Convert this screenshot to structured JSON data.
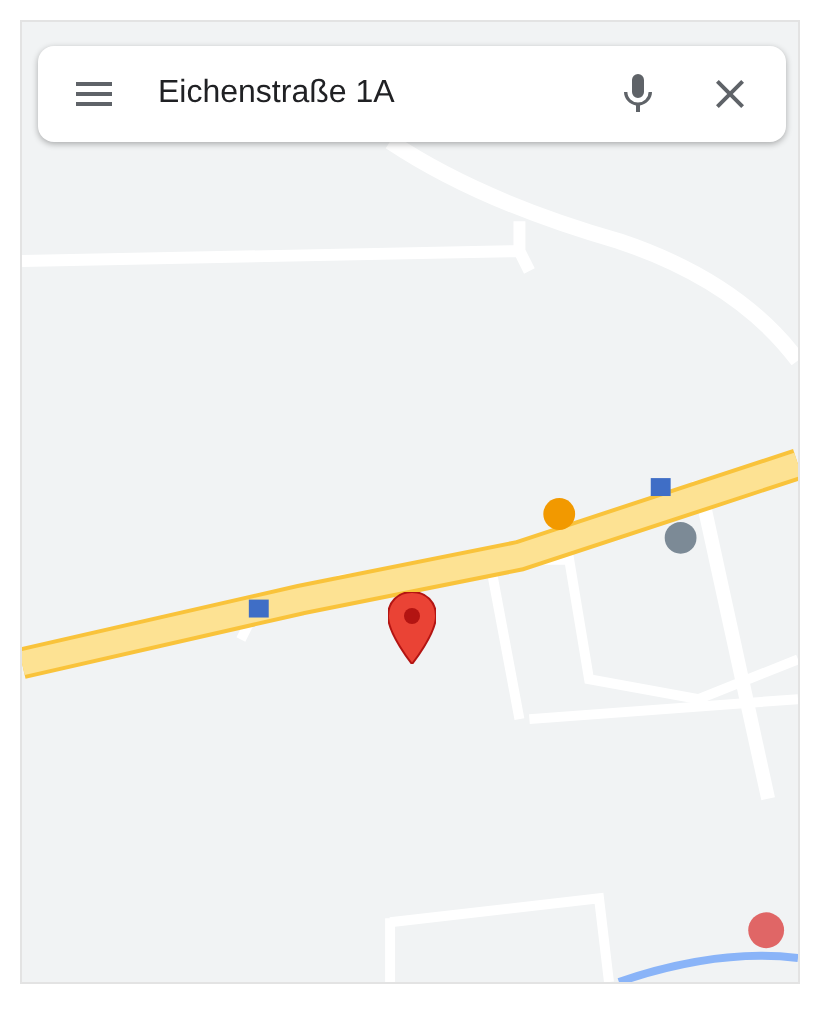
{
  "search": {
    "value": "Eichenstraße 1A"
  }
}
